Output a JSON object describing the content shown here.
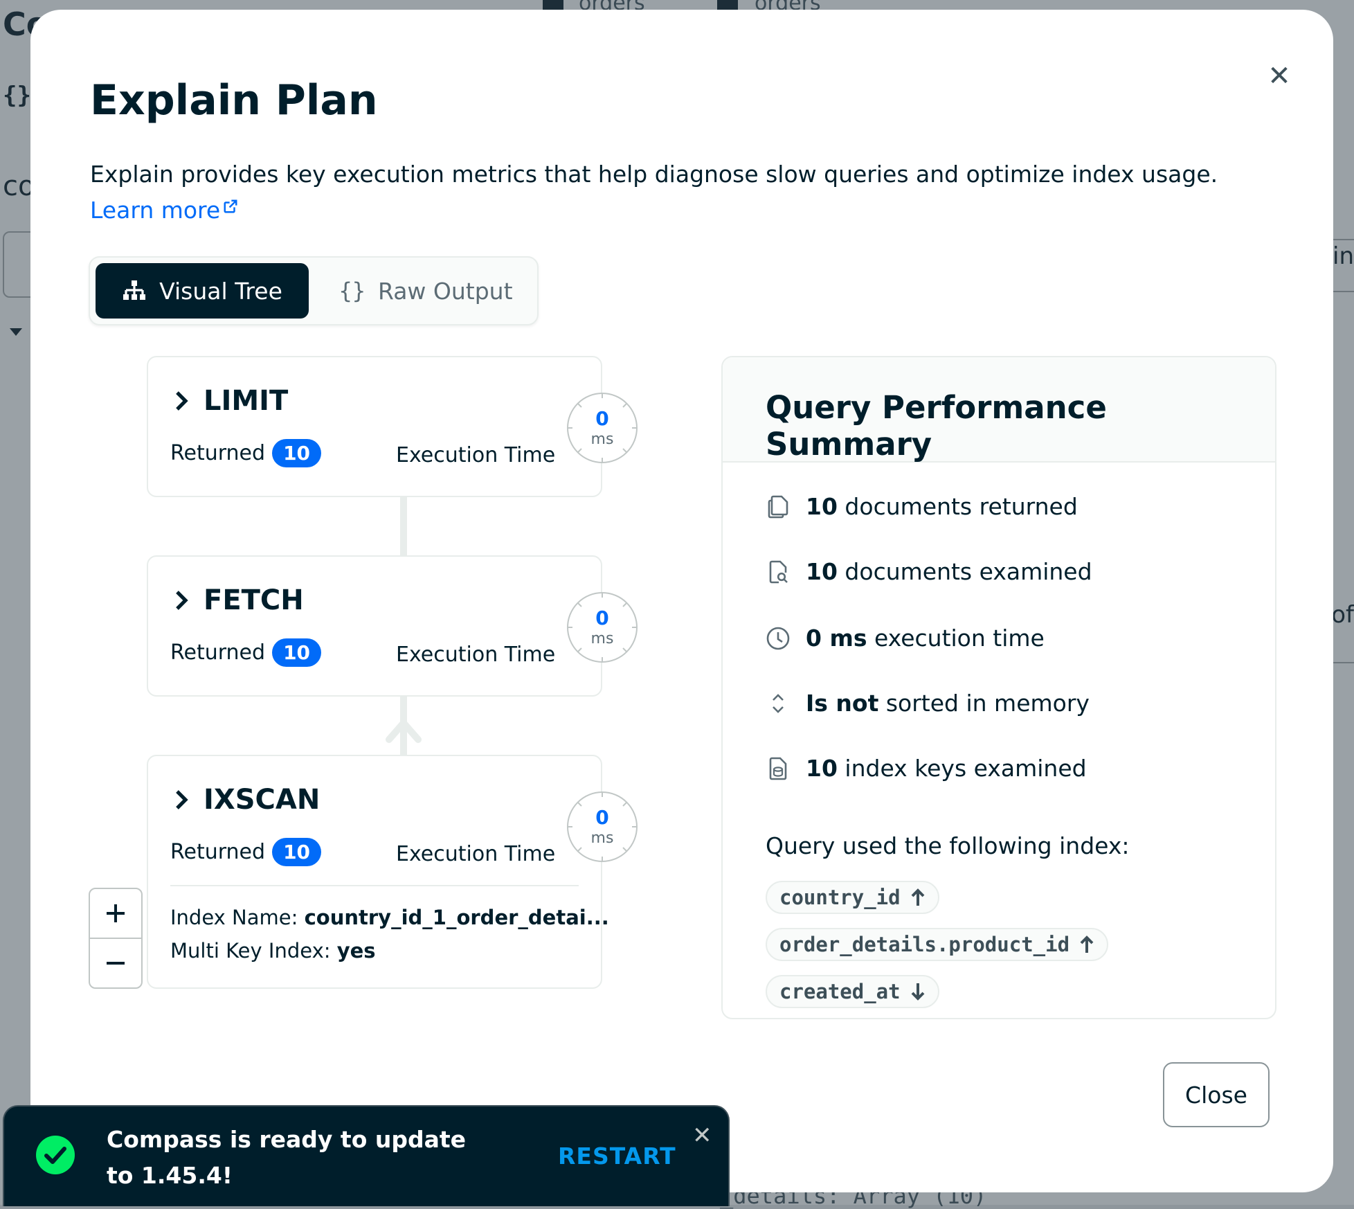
{
  "background": {
    "title_fragment": "Co",
    "braces": "{}",
    "co_fragment": "co",
    "tabs": [
      "orders",
      "orders"
    ],
    "right_fragment_1": "in",
    "right_fragment_2": "of",
    "bottom_code": "_details: Array (10)"
  },
  "modal": {
    "title": "Explain Plan",
    "description": "Explain provides key execution metrics that help diagnose slow queries and optimize index usage. ",
    "learn_more": "Learn more",
    "close_label": "Close"
  },
  "view_toggle": {
    "visual_tree": "Visual Tree",
    "raw_output": "Raw Output",
    "raw_icon": "{}"
  },
  "stages": [
    {
      "name": "LIMIT",
      "returned_label": "Returned",
      "returned": "10",
      "exec_label": "Execution Time",
      "exec_value": "0",
      "exec_unit": "ms"
    },
    {
      "name": "FETCH",
      "returned_label": "Returned",
      "returned": "10",
      "exec_label": "Execution Time",
      "exec_value": "0",
      "exec_unit": "ms"
    },
    {
      "name": "IXSCAN",
      "returned_label": "Returned",
      "returned": "10",
      "exec_label": "Execution Time",
      "exec_value": "0",
      "exec_unit": "ms",
      "index_name_label": "Index Name:",
      "index_name": "country_id_1_order_detai...",
      "multi_key_label": "Multi Key Index:",
      "multi_key": "yes"
    }
  ],
  "summary": {
    "title": "Query Performance Summary",
    "rows": [
      {
        "icon": "documents-icon",
        "bold": "10",
        "text": " documents returned"
      },
      {
        "icon": "document-search-icon",
        "bold": "10",
        "text": " documents examined"
      },
      {
        "icon": "clock-icon",
        "bold": "0 ms",
        "text": " execution time"
      },
      {
        "icon": "sort-icon",
        "bold": "Is not",
        "text": " sorted in memory"
      },
      {
        "icon": "index-icon",
        "bold": "10",
        "text": " index keys examined"
      }
    ],
    "index_label": "Query used the following index:",
    "index_fields": [
      {
        "field": "country_id",
        "direction": "asc"
      },
      {
        "field": "order_details.product_id",
        "direction": "asc"
      },
      {
        "field": "created_at",
        "direction": "desc"
      }
    ]
  },
  "toast": {
    "message": "Compass is ready to update to 1.45.4!",
    "action": "RESTART"
  },
  "colors": {
    "accent_blue": "#016bf8",
    "dark": "#001e2b",
    "success_green": "#00ed64"
  }
}
